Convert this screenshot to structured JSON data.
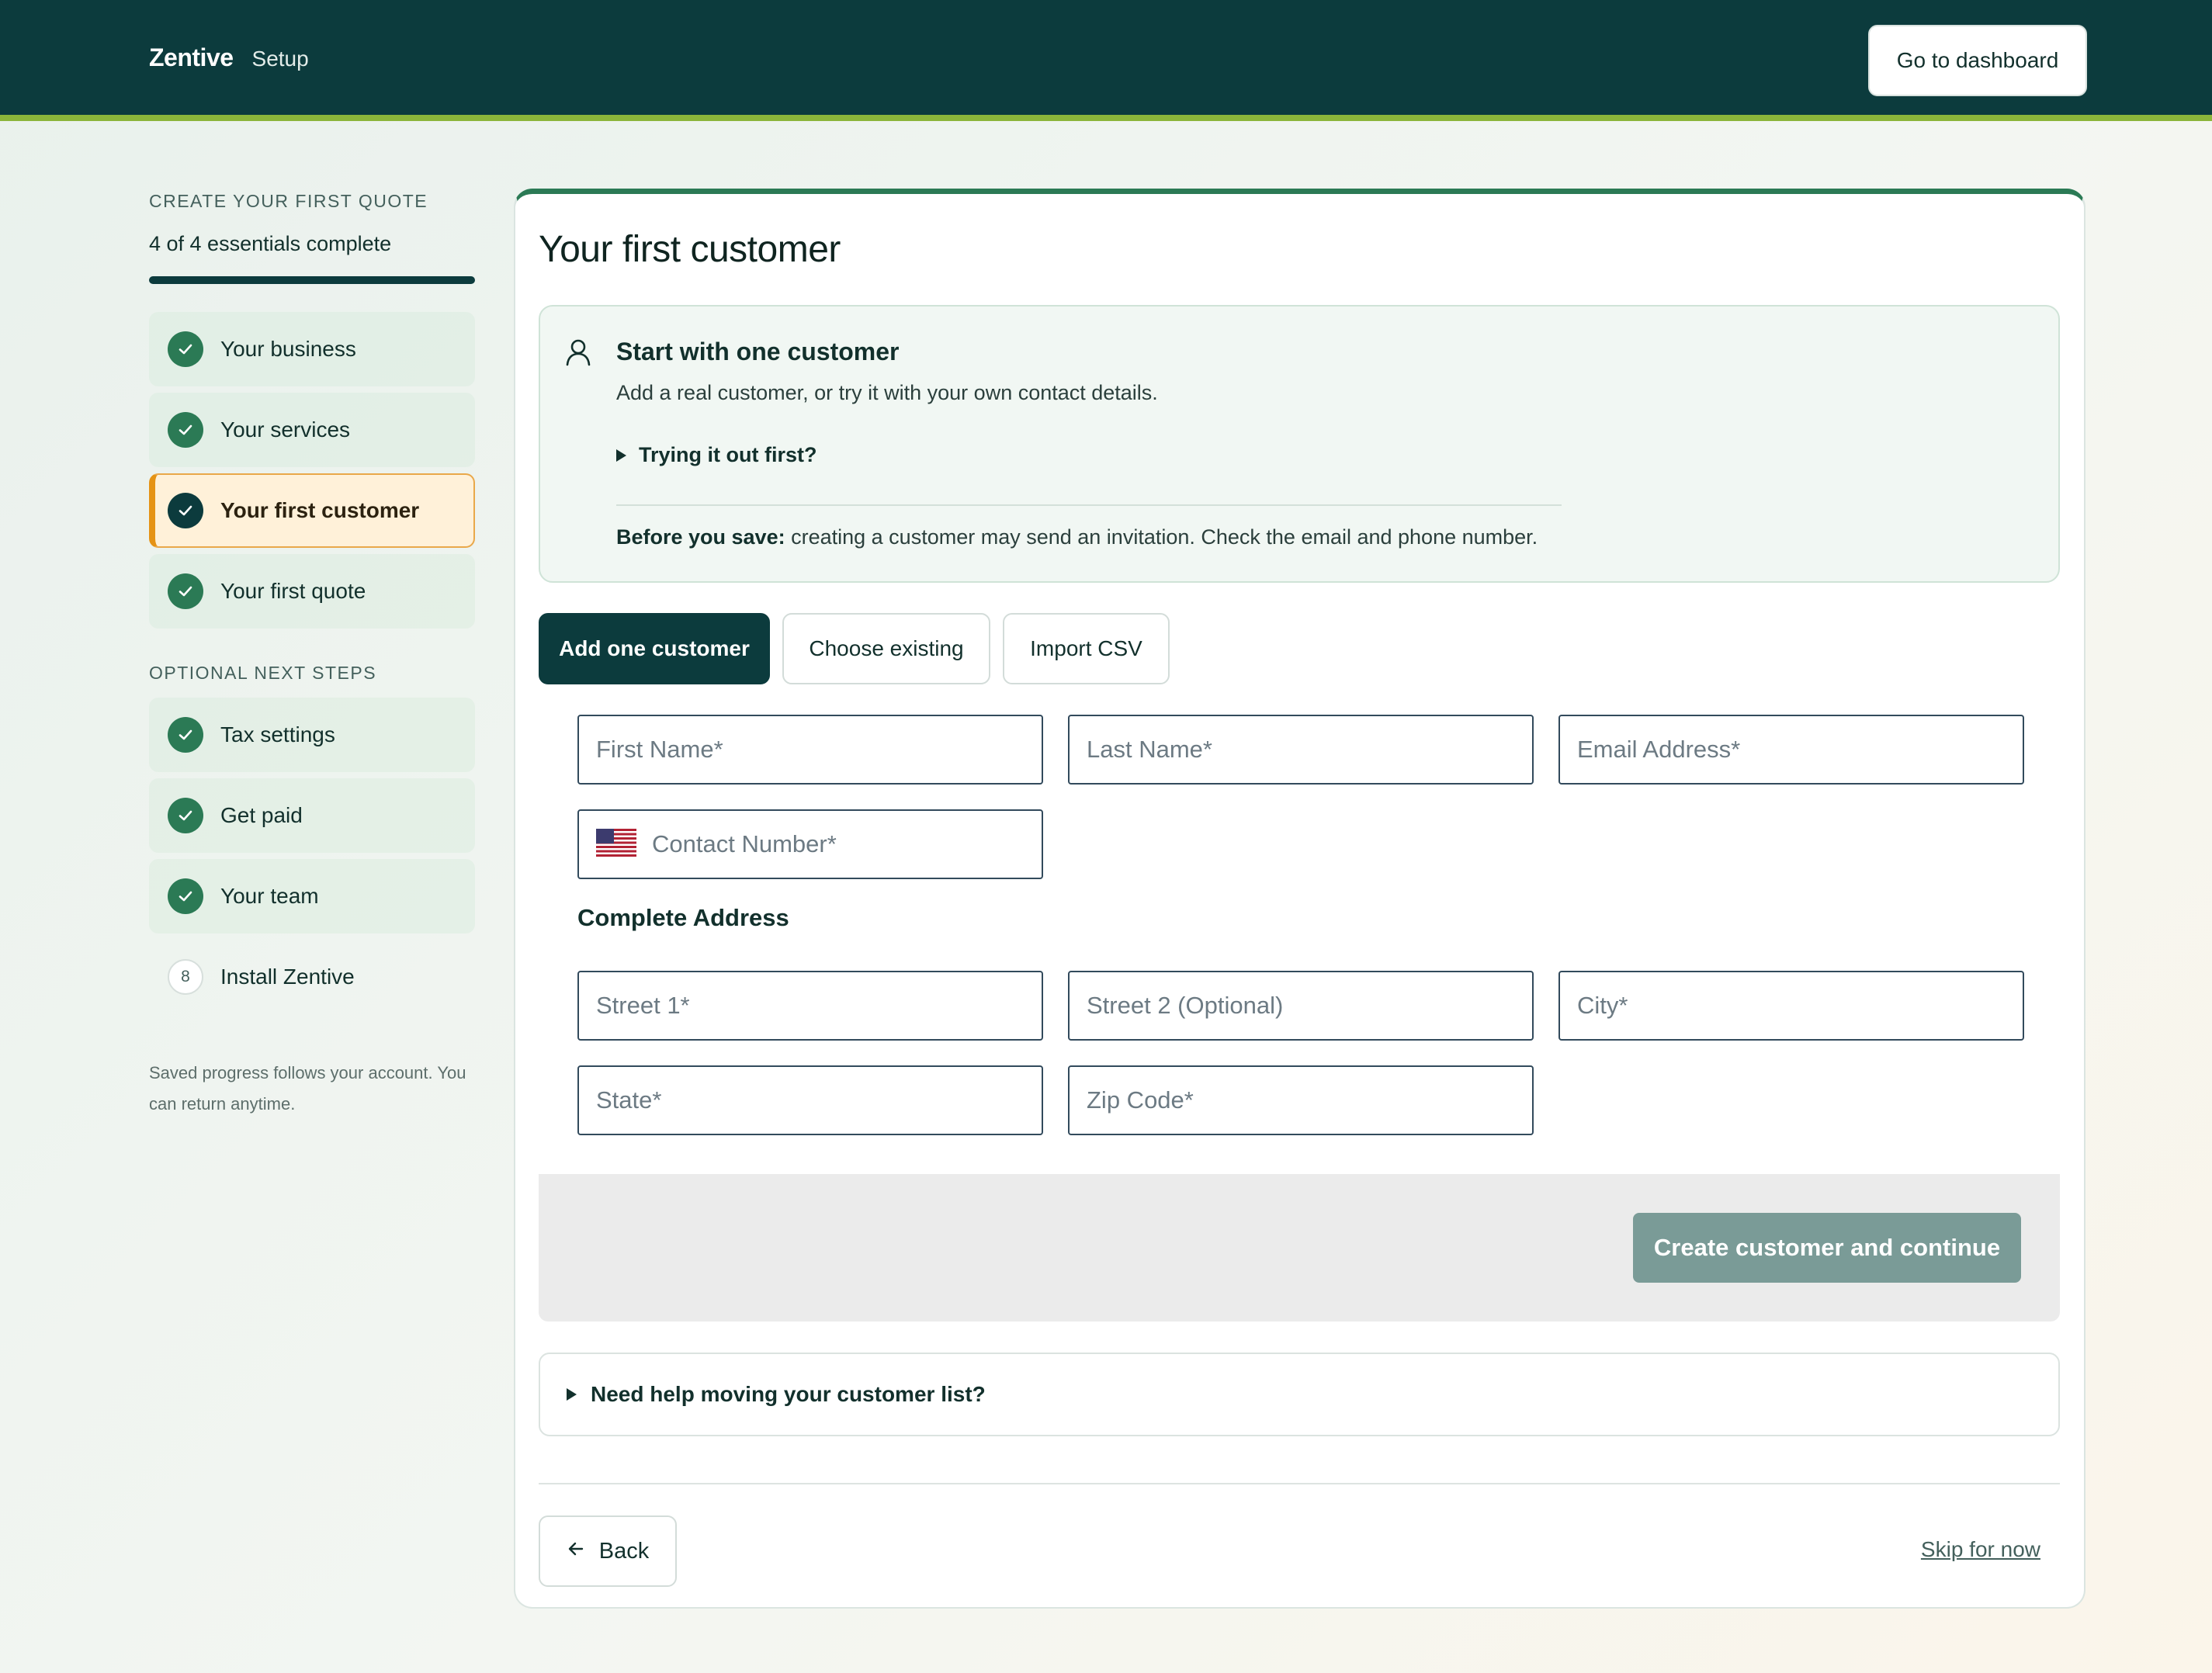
{
  "header": {
    "brand": "Zentive",
    "section": "Setup",
    "dashboard_button": "Go to dashboard"
  },
  "sidebar": {
    "eyebrow": "CREATE YOUR FIRST QUOTE",
    "progress_text": "4 of 4 essentials complete",
    "progress_fraction": 1.0,
    "essentials": [
      {
        "label": "Your business",
        "status": "complete"
      },
      {
        "label": "Your services",
        "status": "complete"
      },
      {
        "label": "Your first customer",
        "status": "current"
      },
      {
        "label": "Your first quote",
        "status": "complete"
      }
    ],
    "optional_title": "OPTIONAL NEXT STEPS",
    "optional": [
      {
        "label": "Tax settings",
        "status": "complete"
      },
      {
        "label": "Get paid",
        "status": "complete"
      },
      {
        "label": "Your team",
        "status": "complete"
      },
      {
        "label": "Install Zentive",
        "status": "pending",
        "number": "8"
      }
    ],
    "note": "Saved progress follows your account. You can return anytime."
  },
  "main": {
    "title": "Your first customer",
    "info": {
      "title": "Start with one customer",
      "subtitle": "Add a real customer, or try it with your own contact details.",
      "toggle": "Trying it out first?",
      "warning_label": "Before you save:",
      "warning_text": "creating a customer may send an invitation. Check the email and phone number."
    },
    "tabs": [
      "Add one customer",
      "Choose existing",
      "Import CSV"
    ],
    "form": {
      "first_name": "First Name*",
      "last_name": "Last Name*",
      "email": "Email Address*",
      "phone": "Contact Number*",
      "address_heading": "Complete Address",
      "street1": "Street 1*",
      "street2": "Street 2 (Optional)",
      "city": "City*",
      "state": "State*",
      "zip": "Zip Code*"
    },
    "create_button": "Create customer and continue",
    "help_toggle": "Need help moving your customer list?",
    "back_button": "Back",
    "skip_link": "Skip for now"
  },
  "colors": {
    "header": "#0c3b3d",
    "accent_green": "#2b7a55",
    "current_step": "#e59315",
    "disabled_button": "#7a9b97"
  }
}
